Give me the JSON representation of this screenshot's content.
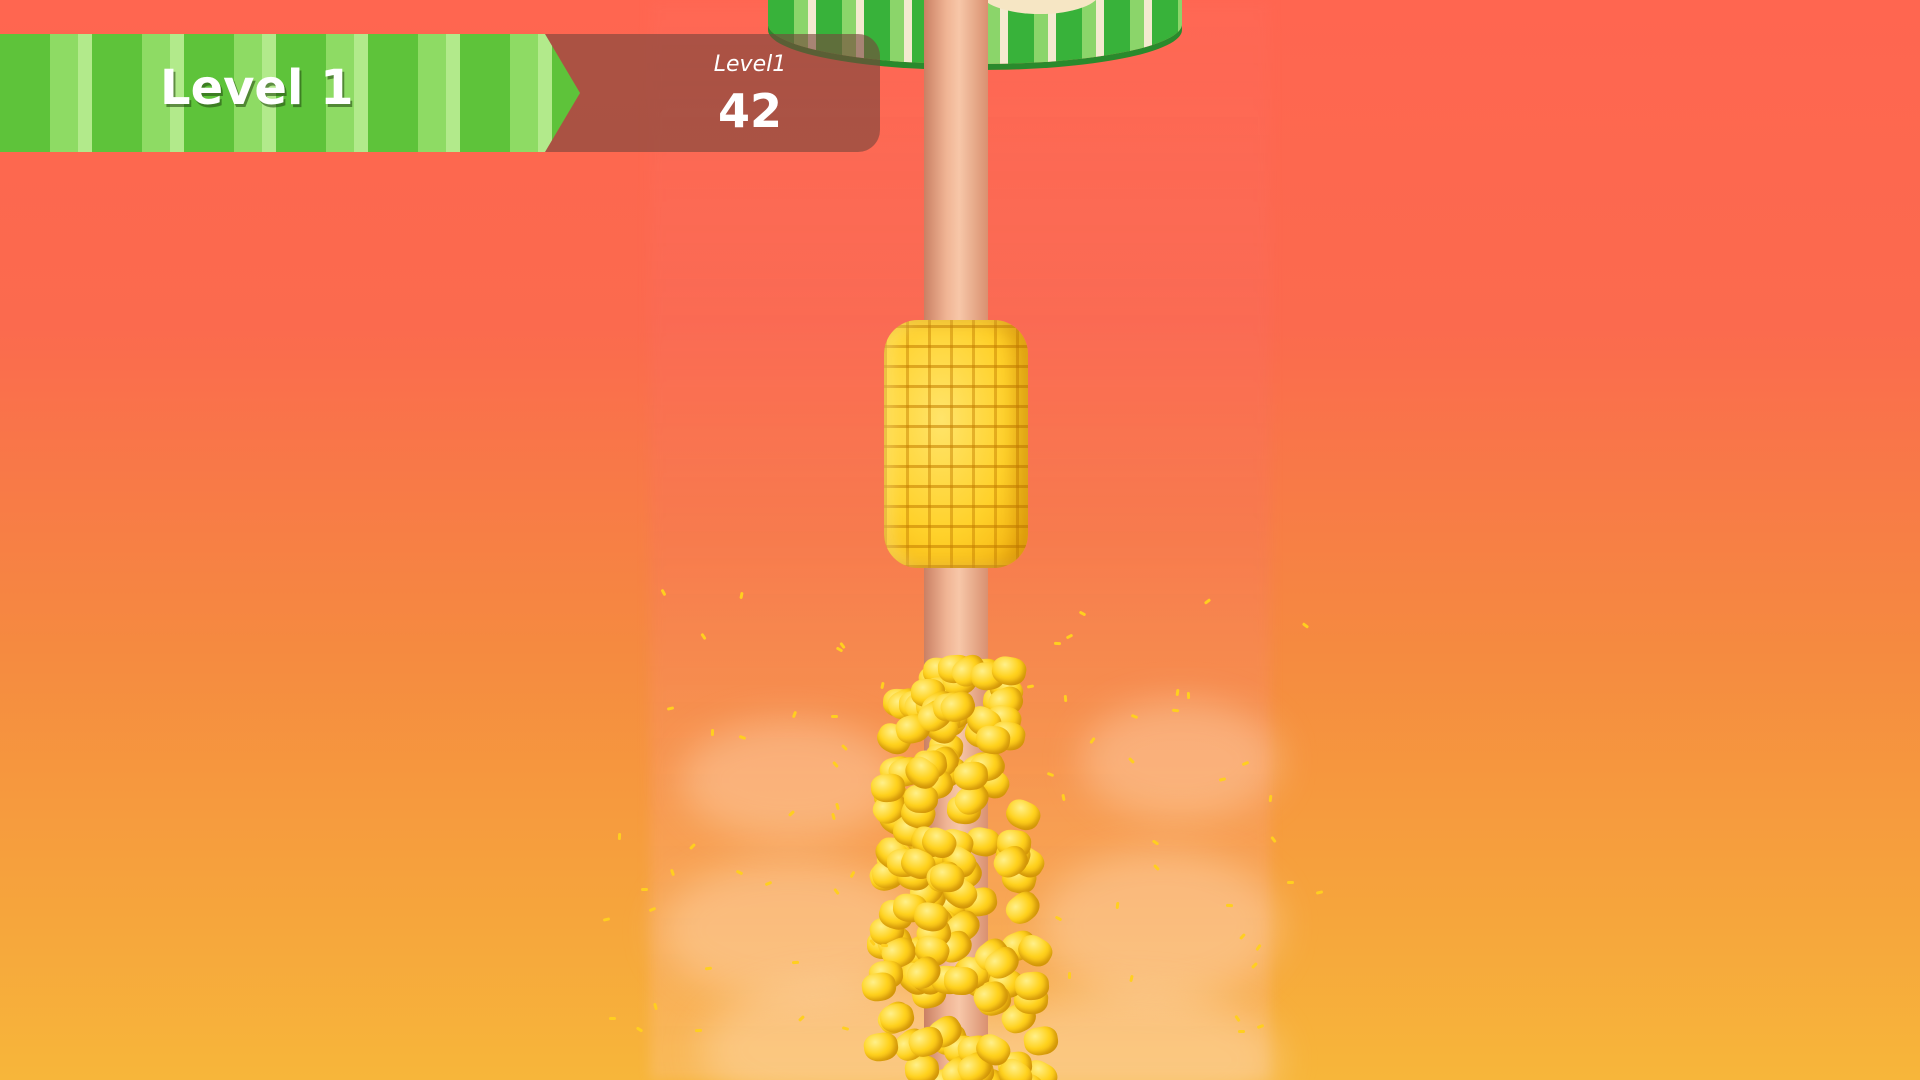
{
  "hud": {
    "level_title": "Level 1",
    "counter_label": "Level1",
    "counter_value": "42"
  },
  "scene": {
    "objects": [
      "green striped platform",
      "wooden stick",
      "corn segment",
      "exploding corn kernels"
    ],
    "colors": {
      "background_top": "#ff6650",
      "background_bottom": "#f7b63a",
      "banner_green": "#5ec33a",
      "corn_yellow": "#ffd12a",
      "stick": "#f0b494"
    }
  }
}
